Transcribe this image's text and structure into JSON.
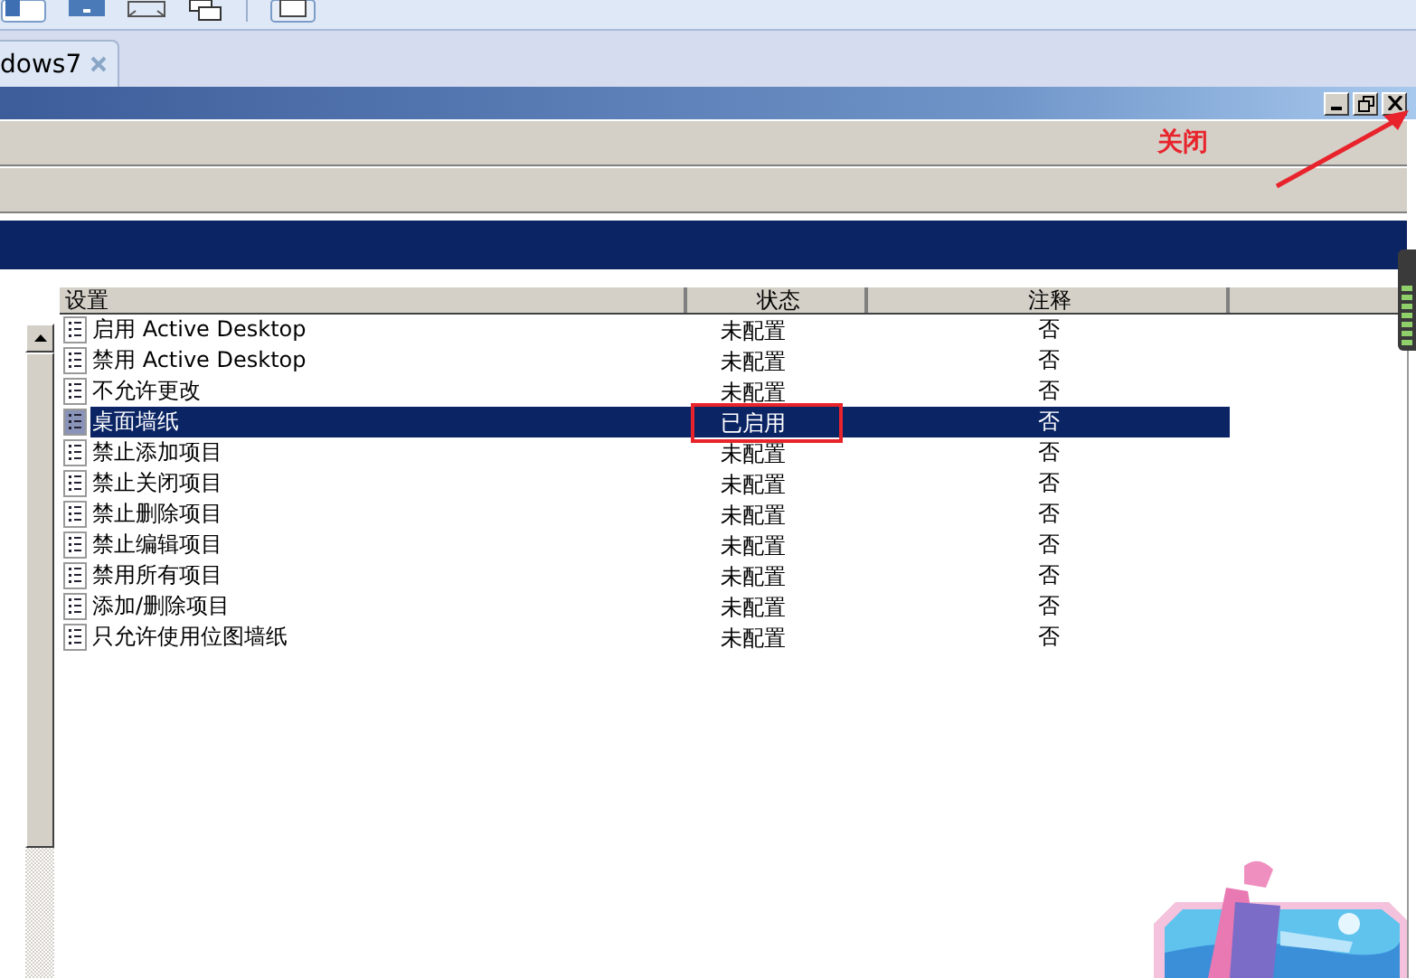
{
  "tab": {
    "label": "dows7",
    "selected": true
  },
  "annotation": {
    "label": "关闭"
  },
  "table": {
    "columns": [
      "设置",
      "状态",
      "注释"
    ],
    "rows": [
      {
        "name": "启用 Active Desktop",
        "state": "未配置",
        "note": "否",
        "selected": false,
        "highlighted": false
      },
      {
        "name": "禁用 Active Desktop",
        "state": "未配置",
        "note": "否",
        "selected": false,
        "highlighted": false
      },
      {
        "name": "不允许更改",
        "state": "未配置",
        "note": "否",
        "selected": false,
        "highlighted": false
      },
      {
        "name": "桌面墙纸",
        "state": "已启用",
        "note": "否",
        "selected": true,
        "highlighted": true
      },
      {
        "name": "禁止添加项目",
        "state": "未配置",
        "note": "否",
        "selected": false,
        "highlighted": false
      },
      {
        "name": "禁止关闭项目",
        "state": "未配置",
        "note": "否",
        "selected": false,
        "highlighted": false
      },
      {
        "name": "禁止删除项目",
        "state": "未配置",
        "note": "否",
        "selected": false,
        "highlighted": false
      },
      {
        "name": "禁止编辑项目",
        "state": "未配置",
        "note": "否",
        "selected": false,
        "highlighted": false
      },
      {
        "name": "禁用所有项目",
        "state": "未配置",
        "note": "否",
        "selected": false,
        "highlighted": false
      },
      {
        "name": "添加/删除项目",
        "state": "未配置",
        "note": "否",
        "selected": false,
        "highlighted": false
      },
      {
        "name": "只允许使用位图墙纸",
        "state": "未配置",
        "note": "否",
        "selected": false,
        "highlighted": false
      }
    ]
  }
}
